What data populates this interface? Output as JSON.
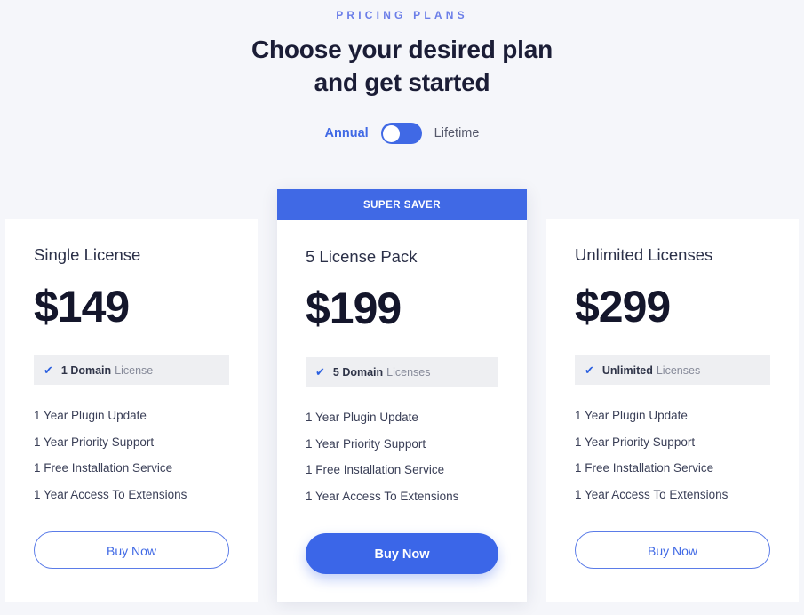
{
  "header": {
    "eyebrow": "PRICING PLANS",
    "headline_line1": "Choose your desired plan",
    "headline_line2": "and get started"
  },
  "billing_toggle": {
    "left_label": "Annual",
    "right_label": "Lifetime",
    "selected": "Annual",
    "knob_position": "left"
  },
  "colors": {
    "accent": "#4069e5",
    "eyebrow": "#6b7ee8",
    "page_background": "#f5f6fa",
    "band_background": "#eeeff2",
    "price_text": "#14162b"
  },
  "icons": {
    "check": "✔"
  },
  "plans": [
    {
      "name": "Single License",
      "price": "$149",
      "badge": null,
      "featured": false,
      "domain_strong": "1 Domain",
      "domain_rest": "License",
      "features": [
        "1 Year Plugin Update",
        "1 Year Priority Support",
        "1 Free Installation Service",
        "1 Year Access To Extensions"
      ],
      "cta": "Buy Now"
    },
    {
      "name": "5 License Pack",
      "price": "$199",
      "badge": "SUPER SAVER",
      "featured": true,
      "domain_strong": "5 Domain",
      "domain_rest": "Licenses",
      "features": [
        "1 Year Plugin Update",
        "1 Year Priority Support",
        "1 Free Installation Service",
        "1 Year Access To Extensions"
      ],
      "cta": "Buy Now"
    },
    {
      "name": "Unlimited Licenses",
      "price": "$299",
      "badge": null,
      "featured": false,
      "domain_strong": "Unlimited",
      "domain_rest": "Licenses",
      "features": [
        "1 Year Plugin Update",
        "1 Year Priority Support",
        "1 Free Installation Service",
        "1 Year Access To Extensions"
      ],
      "cta": "Buy Now"
    }
  ]
}
